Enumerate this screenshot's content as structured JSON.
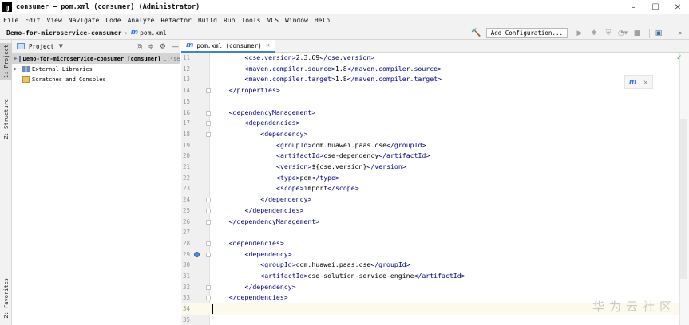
{
  "window": {
    "title": "consumer – pom.xml (consumer) (Administrator)",
    "logo_text": "IJ",
    "controls": [
      "–",
      "☐",
      "✕"
    ]
  },
  "menu": [
    "File",
    "Edit",
    "View",
    "Navigate",
    "Code",
    "Analyze",
    "Refactor",
    "Build",
    "Run",
    "Tools",
    "VCS",
    "Window",
    "Help"
  ],
  "navbar": {
    "project": "Demo-for-microservice-consumer",
    "file_icon": "m",
    "file": "pom.xml",
    "add_config": "Add Configuration..."
  },
  "left_tabs": {
    "project": "1: Project",
    "structure": "Z: Structure",
    "favorites": "2: Favorites"
  },
  "project_panel": {
    "title": "Project",
    "tree": [
      {
        "label": "Demo-for-microservice-consumer [consumer]",
        "suffix": "C:\\se",
        "selected": true,
        "icon": "folder",
        "bold": true
      },
      {
        "label": "External Libraries",
        "suffix": "",
        "selected": false,
        "icon": "lib",
        "bold": false
      },
      {
        "label": "Scratches and Consoles",
        "suffix": "",
        "selected": false,
        "icon": "scratch",
        "bold": false
      }
    ]
  },
  "editor": {
    "tab_icon": "m",
    "tab_label": "pom.xml (consumer)",
    "tab_close": "×",
    "lines": [
      {
        "n": "11",
        "indent": 8,
        "parts": [
          [
            "t",
            "<cse.version>"
          ],
          [
            "p",
            "2.3.69"
          ],
          [
            "t",
            "</cse.version>"
          ]
        ]
      },
      {
        "n": "12",
        "indent": 8,
        "parts": [
          [
            "t",
            "<maven.compiler.source>"
          ],
          [
            "p",
            "1.8"
          ],
          [
            "t",
            "</maven.compiler.source>"
          ]
        ]
      },
      {
        "n": "13",
        "indent": 8,
        "parts": [
          [
            "t",
            "<maven.compiler.target>"
          ],
          [
            "p",
            "1.8"
          ],
          [
            "t",
            "</maven.compiler.target>"
          ]
        ]
      },
      {
        "n": "14",
        "indent": 4,
        "parts": [
          [
            "t",
            "</properties>"
          ]
        ],
        "fold": true
      },
      {
        "n": "15",
        "indent": 0,
        "parts": []
      },
      {
        "n": "16",
        "indent": 4,
        "parts": [
          [
            "t",
            "<dependencyManagement>"
          ]
        ],
        "fold": true
      },
      {
        "n": "17",
        "indent": 8,
        "parts": [
          [
            "t",
            "<dependencies>"
          ]
        ],
        "fold": true
      },
      {
        "n": "18",
        "indent": 12,
        "parts": [
          [
            "t",
            "<dependency>"
          ]
        ],
        "fold": true
      },
      {
        "n": "19",
        "indent": 16,
        "parts": [
          [
            "t",
            "<groupId>"
          ],
          [
            "p",
            "com.huawei.paas.cse"
          ],
          [
            "t",
            "</groupId>"
          ]
        ]
      },
      {
        "n": "20",
        "indent": 16,
        "parts": [
          [
            "t",
            "<artifactId>"
          ],
          [
            "p",
            "cse-dependency"
          ],
          [
            "t",
            "</artifactId>"
          ]
        ]
      },
      {
        "n": "21",
        "indent": 16,
        "parts": [
          [
            "t",
            "<version>"
          ],
          [
            "p",
            "${cse.version}"
          ],
          [
            "t",
            "</version>"
          ]
        ]
      },
      {
        "n": "22",
        "indent": 16,
        "parts": [
          [
            "t",
            "<type>"
          ],
          [
            "p",
            "pom"
          ],
          [
            "t",
            "</type>"
          ]
        ]
      },
      {
        "n": "23",
        "indent": 16,
        "parts": [
          [
            "t",
            "<scope>"
          ],
          [
            "p",
            "import"
          ],
          [
            "t",
            "</scope>"
          ]
        ]
      },
      {
        "n": "24",
        "indent": 12,
        "parts": [
          [
            "t",
            "</dependency>"
          ]
        ],
        "fold": true
      },
      {
        "n": "25",
        "indent": 8,
        "parts": [
          [
            "t",
            "</dependencies>"
          ]
        ],
        "fold": true
      },
      {
        "n": "26",
        "indent": 4,
        "parts": [
          [
            "t",
            "</dependencyManagement>"
          ]
        ],
        "fold": true
      },
      {
        "n": "27",
        "indent": 0,
        "parts": []
      },
      {
        "n": "28",
        "indent": 4,
        "parts": [
          [
            "t",
            "<dependencies>"
          ]
        ],
        "fold": true
      },
      {
        "n": "29",
        "indent": 8,
        "parts": [
          [
            "t",
            "<dependency>"
          ]
        ],
        "fold": true,
        "gutter_icon": true
      },
      {
        "n": "30",
        "indent": 12,
        "parts": [
          [
            "t",
            "<groupId>"
          ],
          [
            "p",
            "com.huawei.paas.cse"
          ],
          [
            "t",
            "</groupId>"
          ]
        ]
      },
      {
        "n": "31",
        "indent": 12,
        "parts": [
          [
            "t",
            "<artifactId>"
          ],
          [
            "p",
            "cse-solution-service-engine"
          ],
          [
            "t",
            "</artifactId>"
          ]
        ]
      },
      {
        "n": "32",
        "indent": 8,
        "parts": [
          [
            "t",
            "</dependency>"
          ]
        ],
        "fold": true
      },
      {
        "n": "33",
        "indent": 4,
        "parts": [
          [
            "t",
            "</dependencies>"
          ]
        ],
        "fold": true
      },
      {
        "n": "34",
        "indent": 0,
        "parts": [],
        "current": true
      },
      {
        "n": "35",
        "indent": 0,
        "parts": []
      }
    ]
  },
  "maven_popup": {
    "icon": "m",
    "close": "×"
  },
  "watermark": "华为云社区",
  "colors": {
    "tag": "#000080",
    "accent": "#4083c9"
  }
}
